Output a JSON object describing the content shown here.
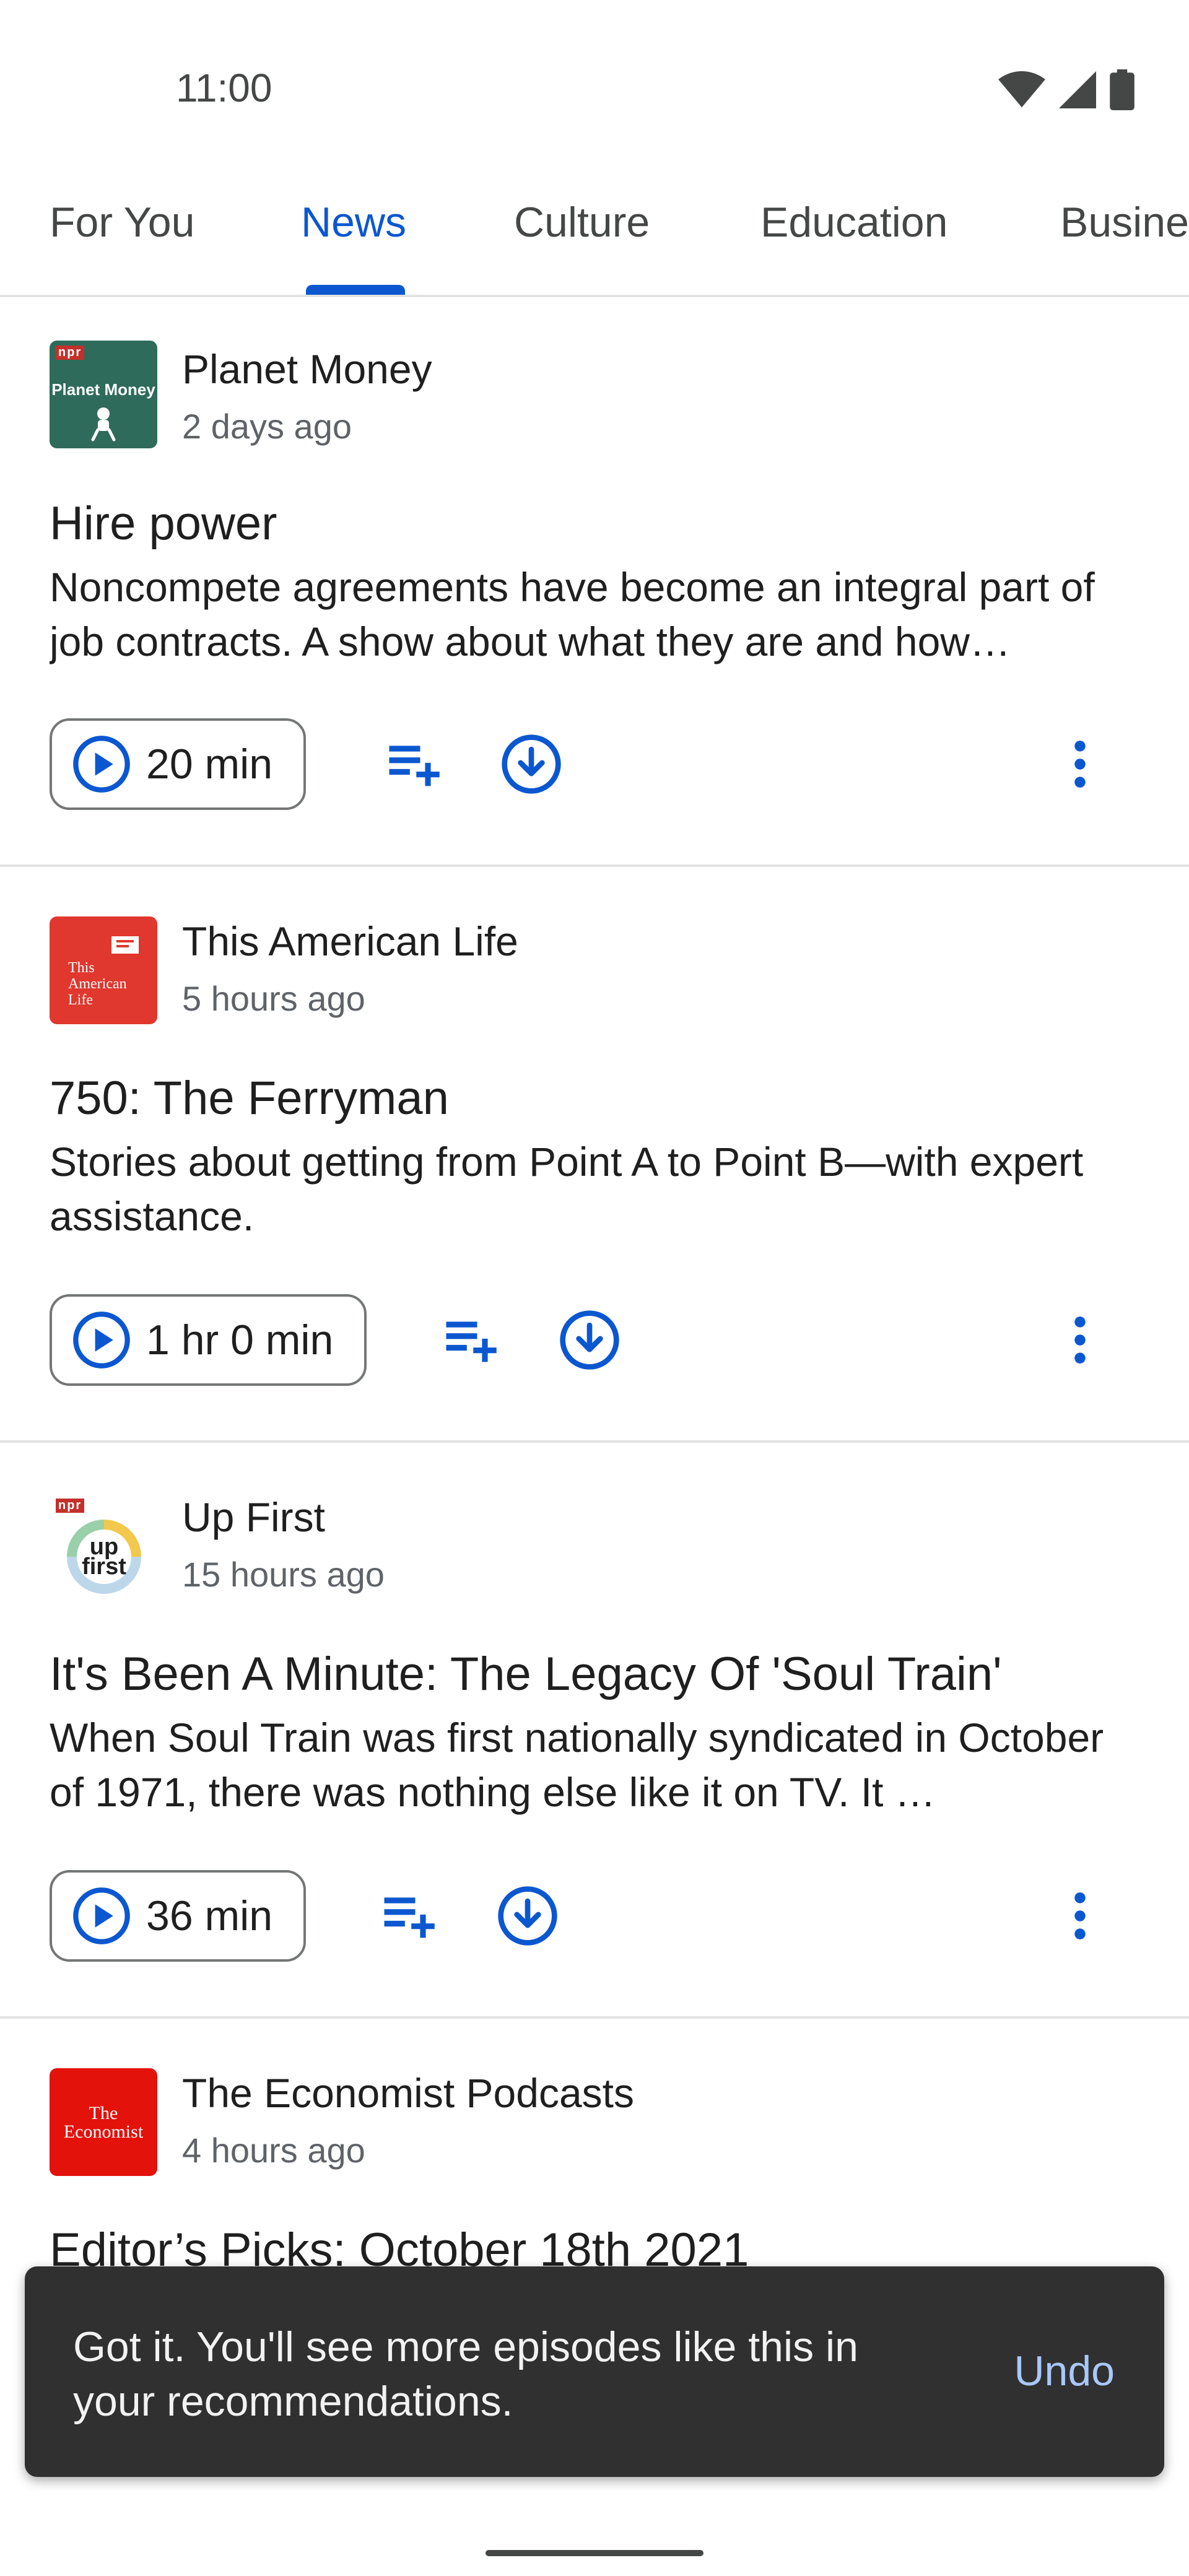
{
  "status_bar": {
    "time": "11:00",
    "icons": [
      "wifi-icon",
      "cellular-signal-icon",
      "battery-icon"
    ]
  },
  "tabs": [
    {
      "label": "For You",
      "active": false
    },
    {
      "label": "News",
      "active": true
    },
    {
      "label": "Culture",
      "active": false
    },
    {
      "label": "Education",
      "active": false
    },
    {
      "label": "Busine",
      "active": false
    }
  ],
  "episodes": [
    {
      "show": "Planet Money",
      "cover_text": "Planet Money",
      "cover_badge": "npr",
      "time": "2 days ago",
      "title": "Hire power",
      "description": "Noncompete agreements have become an integral part of job contracts. A show about what they are and how…",
      "duration": "20 min"
    },
    {
      "show": "This American Life",
      "cover_text": "This American Life",
      "time": "5 hours ago",
      "title": "750: The Ferryman",
      "description": "Stories about getting from Point A to Point B—with expert assistance.",
      "duration": "1 hr 0 min"
    },
    {
      "show": "Up First",
      "cover_text": "up first",
      "cover_badge": "npr",
      "time": "15 hours ago",
      "title": "It's Been A Minute: The Legacy Of 'Soul Train'",
      "description": "When Soul Train was first nationally syndicated in October of 1971, there was nothing else like it on TV. It …",
      "duration": "36 min"
    },
    {
      "show": "The Economist Podcasts",
      "cover_text": "The Economist",
      "time": "4 hours ago",
      "title": "Editor’s Picks: October 18th 2021"
    }
  ],
  "snackbar": {
    "message": "Got it. You'll see more episodes like this in your recommendations.",
    "action": "Undo"
  },
  "colors": {
    "accent": "#0b57d0",
    "snackbar_bg": "#303030",
    "snackbar_action": "#a8c7fa"
  }
}
